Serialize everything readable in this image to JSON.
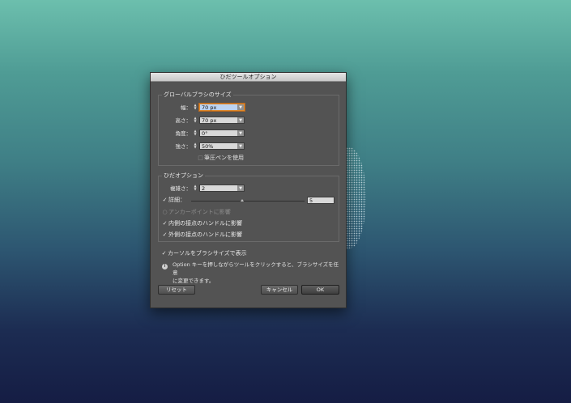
{
  "dialog": {
    "title": "ひだツールオプション",
    "global_brush_group": {
      "legend": "グローバルブラシのサイズ",
      "width": {
        "label": "幅：",
        "value": "70 px"
      },
      "height": {
        "label": "高さ：",
        "value": "70 px"
      },
      "angle": {
        "label": "角度：",
        "value": "0°"
      },
      "intensity": {
        "label": "強さ：",
        "value": "50%"
      },
      "pressure_pen": {
        "label": "筆圧ペンを使用",
        "checked": false
      }
    },
    "crinkle_group": {
      "legend": "ひだオプション",
      "complexity": {
        "label": "複雑さ：",
        "value": "2"
      },
      "detail": {
        "label": "詳細：",
        "value": "5",
        "checked": true,
        "slider_fraction": 0.45
      },
      "anchor_points": {
        "label": "アンカーポイントに影響",
        "checked": false,
        "disabled": true
      },
      "in_tangent": {
        "label": "内側の接点のハンドルに影響",
        "checked": true
      },
      "out_tangent": {
        "label": "外側の接点のハンドルに影響",
        "checked": true
      }
    },
    "show_brush_size": {
      "label": "カーソルをブラシサイズで表示",
      "checked": true
    },
    "info": {
      "line1": "Option キーを押しながらツールをクリックすると、ブラシサイズを任意",
      "line2": "に変更できます。"
    },
    "buttons": {
      "reset": "リセット",
      "cancel": "キャンセル",
      "ok": "OK"
    }
  },
  "icons": {
    "checkmark": "✓",
    "dropdown": "▼",
    "spinner_up": "▲",
    "spinner_down": "▼",
    "info": "i"
  }
}
